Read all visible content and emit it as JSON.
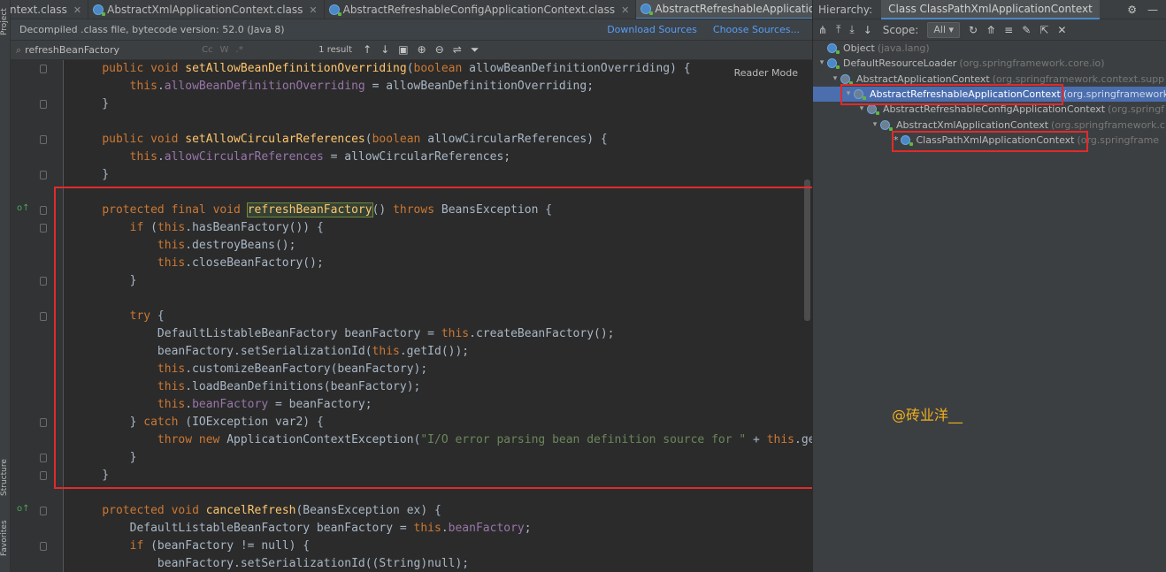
{
  "sidebar": {
    "project_label": "Project",
    "structure_label": "Structure",
    "favorites_label": "Favorites"
  },
  "tabs": [
    {
      "label": "ntext.class",
      "active": false
    },
    {
      "label": "AbstractXmlApplicationContext.class",
      "active": false
    },
    {
      "label": "AbstractRefreshableConfigApplicationContext.class",
      "active": false
    },
    {
      "label": "AbstractRefreshableApplicationContext.class",
      "active": true
    }
  ],
  "notice": {
    "text": "Decompiled .class file, bytecode version: 52.0 (Java 8)",
    "download_sources": "Download Sources",
    "choose_sources": "Choose Sources..."
  },
  "search": {
    "value": "refreshBeanFactory",
    "result_count": "1 result",
    "options": [
      "Cc",
      "W",
      ".*"
    ]
  },
  "editor": {
    "reader_mode": "Reader Mode",
    "code_lines": [
      "    public void setAllowBeanDefinitionOverriding(boolean allowBeanDefinitionOverriding) {",
      "        this.allowBeanDefinitionOverriding = allowBeanDefinitionOverriding;",
      "    }",
      "",
      "    public void setAllowCircularReferences(boolean allowCircularReferences) {",
      "        this.allowCircularReferences = allowCircularReferences;",
      "    }",
      "",
      "    protected final void refreshBeanFactory() throws BeansException {",
      "        if (this.hasBeanFactory()) {",
      "            this.destroyBeans();",
      "            this.closeBeanFactory();",
      "        }",
      "",
      "        try {",
      "            DefaultListableBeanFactory beanFactory = this.createBeanFactory();",
      "            beanFactory.setSerializationId(this.getId());",
      "            this.customizeBeanFactory(beanFactory);",
      "            this.loadBeanDefinitions(beanFactory);",
      "            this.beanFactory = beanFactory;",
      "        } catch (IOException var2) {",
      "            throw new ApplicationContextException(\"I/O error parsing bean definition source for \" + this.getDispl",
      "        }",
      "    }",
      "",
      "    protected void cancelRefresh(BeansException ex) {",
      "        DefaultListableBeanFactory beanFactory = this.beanFactory;",
      "        if (beanFactory != null) {",
      "            beanFactory.setSerializationId((String)null);"
    ]
  },
  "hierarchy": {
    "title_label": "Hierarchy:",
    "tab_label": "Class ClassPathXmlApplicationContext",
    "scope_label": "Scope:",
    "scope_value": "All",
    "nodes": [
      {
        "name": "Object",
        "pkg": "(java.lang)",
        "depth": 0,
        "expanded": false
      },
      {
        "name": "DefaultResourceLoader",
        "pkg": "(org.springframework.core.io)",
        "depth": 0,
        "expanded": true
      },
      {
        "name": "AbstractApplicationContext",
        "pkg": "(org.springframework.context.supp",
        "depth": 1,
        "expanded": true
      },
      {
        "name": "AbstractRefreshableApplicationContext",
        "pkg": "(org.springframework",
        "depth": 2,
        "expanded": true
      },
      {
        "name": "AbstractRefreshableConfigApplicationContext",
        "pkg": "(org.springf",
        "depth": 3,
        "expanded": true
      },
      {
        "name": "AbstractXmlApplicationContext",
        "pkg": "(org.springframework.c",
        "depth": 4,
        "expanded": true
      },
      {
        "name": "ClassPathXmlApplicationContext",
        "pkg": "(org.springframe",
        "depth": 5,
        "expanded": false,
        "starred": true
      }
    ]
  },
  "watermark": "@砖业洋__",
  "colors": {
    "keyword": "#cc7832",
    "method": "#ffc66d",
    "field": "#9876aa",
    "string": "#6a8759",
    "annotation_box": "#e02b2b",
    "selection": "#4b6eaf"
  }
}
